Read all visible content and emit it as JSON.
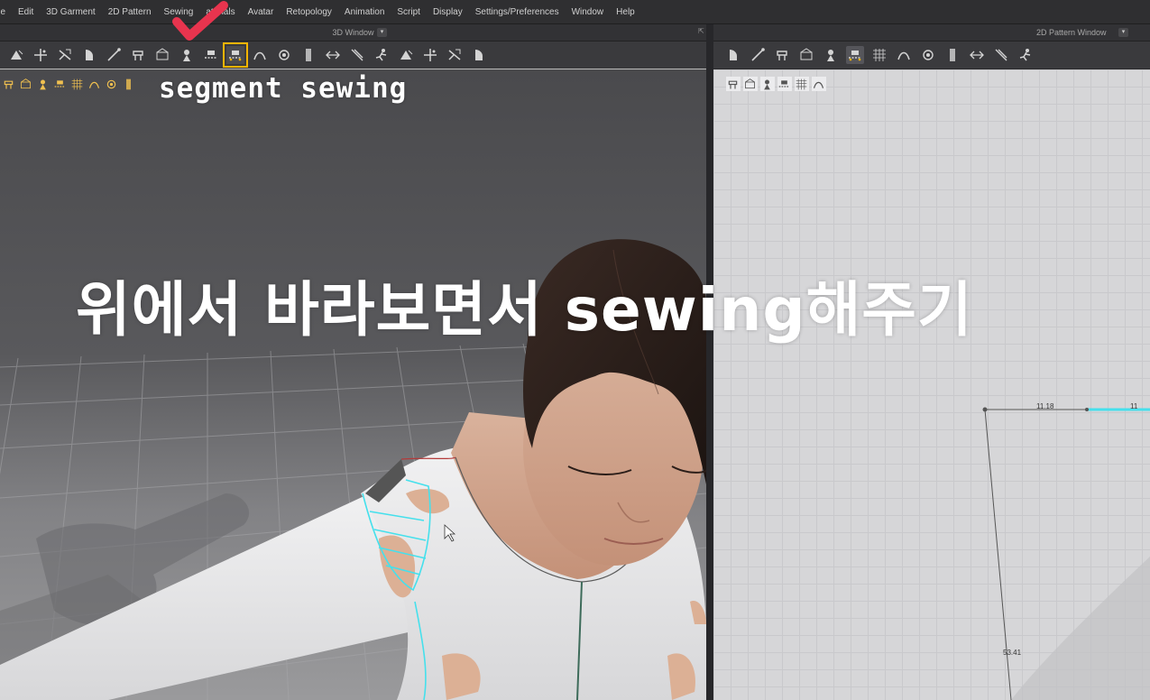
{
  "menu": [
    "ile",
    "Edit",
    "3D Garment",
    "2D Pattern",
    "Sewing",
    "aterials",
    "Avatar",
    "Retopology",
    "Animation",
    "Script",
    "Display",
    "Settings/Preferences",
    "Window",
    "Help"
  ],
  "windows": {
    "left_title": "3D Window",
    "right_title": "2D Pattern Window",
    "dropdown_glyph": "▾"
  },
  "toolbar3d_icons": [
    "select-mesh-icon",
    "transform-pattern-icon",
    "fold-arrangement-icon",
    "brush-icon",
    "pin-icon",
    "tack-icon",
    "pattern-arrange-icon",
    "arrange-point-icon",
    "edit-sewing-icon",
    "segment-sewing-icon",
    "grid-icon",
    "edit-curve-icon",
    "pull-icon",
    "point-icon",
    "avatar-measure-icon",
    "fabric-icon",
    "solid-icon",
    "stretch-icon",
    "zipper-icon",
    "pose-icon"
  ],
  "toolbar3d_highlight": "segment-sewing-icon",
  "subtools3d": [
    "shirt-icon",
    "cursor-icon",
    "avatar-icon",
    "pencil-icon",
    "eraser-icon",
    "skin-icon",
    "texture-icon",
    "export-icon"
  ],
  "toolbar2d_icons": [
    "transform-icon",
    "edit-point-icon",
    "polygon-icon",
    "rectangle-icon",
    "internal-line-icon",
    "segment-sewing-icon",
    "grid-icon",
    "trace-icon",
    "fold-icon",
    "edit-sewing-icon",
    "sewing-free-icon",
    "gradient-icon",
    "garment-icon"
  ],
  "toolbar2d_active": "segment-sewing-icon",
  "subtools2d": [
    "pen-icon",
    "cursor-icon",
    "color-icon",
    "layer-icon",
    "copy-icon",
    "export-icon"
  ],
  "captions": {
    "tool_name": "segment sewing",
    "instruction": "위에서 바라보면서 sewing해주기"
  },
  "pattern_measurements": {
    "top_edge": "11.18",
    "top_edge_right": "11",
    "left_edge": "53.41"
  },
  "colors": {
    "highlight": "#f4b400",
    "checkmark": "#e8344e",
    "sewing_line": "#45e0ec"
  }
}
